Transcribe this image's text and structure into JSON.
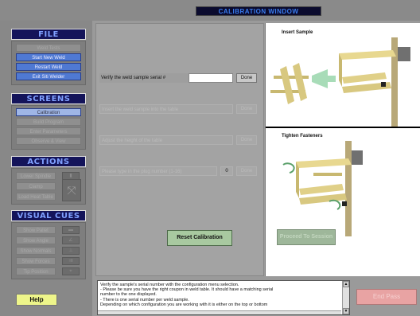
{
  "window": {
    "title": "CALIBRATION WINDOW"
  },
  "sidebar": {
    "file": {
      "header": "FILE",
      "items": [
        {
          "label": "Weld Tests"
        },
        {
          "label": "Start New Weld"
        },
        {
          "label": "Restart Weld"
        },
        {
          "label": "Exit Siti Welder"
        }
      ]
    },
    "screens": {
      "header": "SCREENS",
      "items": [
        {
          "label": "Calibration"
        },
        {
          "label": "Build Program"
        },
        {
          "label": "Enter Parameters"
        },
        {
          "label": "Observe & View"
        }
      ]
    },
    "actions": {
      "header": "ACTIONS",
      "items": [
        {
          "label": "Lower Spindle"
        },
        {
          "label": "Clamp"
        },
        {
          "label": "Load Heat Table"
        }
      ]
    },
    "visual_cues": {
      "header": "VISUAL CUES",
      "items": [
        {
          "label": "Show Pallet"
        },
        {
          "label": "Show Angle"
        },
        {
          "label": "Show Normals"
        },
        {
          "label": "Show Forces"
        },
        {
          "label": "Tip Position"
        }
      ]
    },
    "help_label": "Help"
  },
  "form": {
    "rows": [
      {
        "label": "Verify the weld sample serial #",
        "value": "",
        "button": "Done",
        "enabled": true
      },
      {
        "label": "Insert the weld sample into the table",
        "button": "Done",
        "enabled": false
      },
      {
        "label": "Adjust the height of the table",
        "button": "Done",
        "enabled": false
      },
      {
        "label": "Please type in the plug number (1-16)",
        "value": "0",
        "button": "Done",
        "enabled": false
      }
    ]
  },
  "images": {
    "top_caption": "Insert Sample",
    "bottom_caption": "Tighten Fasteners"
  },
  "buttons": {
    "reset": "Reset Calibration",
    "proceed": "Proceed To Session",
    "end_pass": "End Pass"
  },
  "message": {
    "lines": [
      "Verify the sample's serial number with the configuration menu selection.",
      "- Please be sure you have the right coupon in weld table. It should have a matching serial",
      "number to the one displayed.",
      "- There is one serial number per weld sample.",
      "Depending on which configuration you are working with it is either on the top or bottom"
    ]
  },
  "colors": {
    "title_bg": "#0b0b2e",
    "section_header_bg": "#14145a",
    "active_button": "#4f79d3",
    "reset_button": "#a8c9a0",
    "end_pass": "#e8a3a3",
    "help": "#eef58a"
  }
}
